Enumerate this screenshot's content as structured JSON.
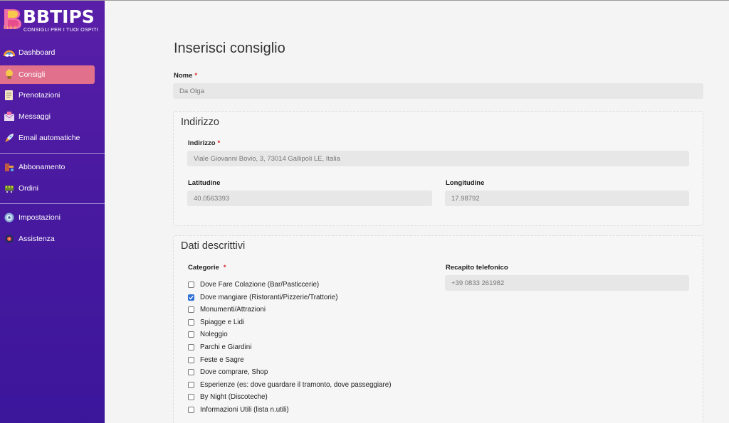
{
  "brand": {
    "name": "BBTIPS",
    "tagline": "CONSIGLI PER I TUOI OSPITI",
    "mark_text": "TIPS"
  },
  "sidebar": {
    "items": [
      {
        "label": "Dashboard",
        "icon": "rainbow-icon"
      },
      {
        "label": "Consigli",
        "icon": "lightbulb-icon",
        "active": true
      },
      {
        "label": "Prenotazioni",
        "icon": "document-icon"
      },
      {
        "label": "Messaggi",
        "icon": "envelope-icon"
      },
      {
        "label": "Email automatiche",
        "icon": "rocket-icon"
      },
      {
        "label": "Abbonamento",
        "icon": "tap-icon"
      },
      {
        "label": "Ordini",
        "icon": "cart-icon"
      },
      {
        "label": "Impostazioni",
        "icon": "gear-icon"
      },
      {
        "label": "Assistenza",
        "icon": "support-icon"
      }
    ]
  },
  "form": {
    "title": "Inserisci consiglio",
    "nome": {
      "label": "Nome",
      "value": "Da Olga"
    },
    "indirizzo_section": {
      "legend": "Indirizzo",
      "indirizzo": {
        "label": "Indirizzo",
        "value": "Viale Giovanni Bovio, 3, 73014 Gallipoli LE, Italia"
      },
      "latitudine": {
        "label": "Latitudine",
        "value": "40.0563393"
      },
      "longitudine": {
        "label": "Longitudine",
        "value": "17.98792"
      }
    },
    "dati_section": {
      "legend": "Dati descrittivi",
      "categorie_label": "Categorie",
      "recapito": {
        "label": "Recapito telefonico",
        "value": "+39 0833 261982"
      },
      "categories": [
        {
          "label": "Dove Fare Colazione (Bar/Pasticcerie)",
          "checked": false
        },
        {
          "label": "Dove mangiare (Ristoranti/Pizzerie/Trattorie)",
          "checked": true
        },
        {
          "label": "Monumenti/Attrazioni",
          "checked": false
        },
        {
          "label": "Spiagge e Lidi",
          "checked": false
        },
        {
          "label": "Noleggio",
          "checked": false
        },
        {
          "label": "Parchi e Giardini",
          "checked": false
        },
        {
          "label": "Feste e Sagre",
          "checked": false
        },
        {
          "label": "Dove comprare, Shop",
          "checked": false
        },
        {
          "label": "Esperienze (es: dove guardare il tramonto, dove passeggiare)",
          "checked": false
        },
        {
          "label": "By Night (Discoteche)",
          "checked": false
        },
        {
          "label": "Informazioni Utili (lista n.utili)",
          "checked": false
        }
      ]
    },
    "required_marker": "*"
  },
  "colors": {
    "sidebar": "#4a1aa0",
    "active_item": "#e0708c",
    "checkbox_checked": "#2f6fd6",
    "required": "#d8232a"
  }
}
